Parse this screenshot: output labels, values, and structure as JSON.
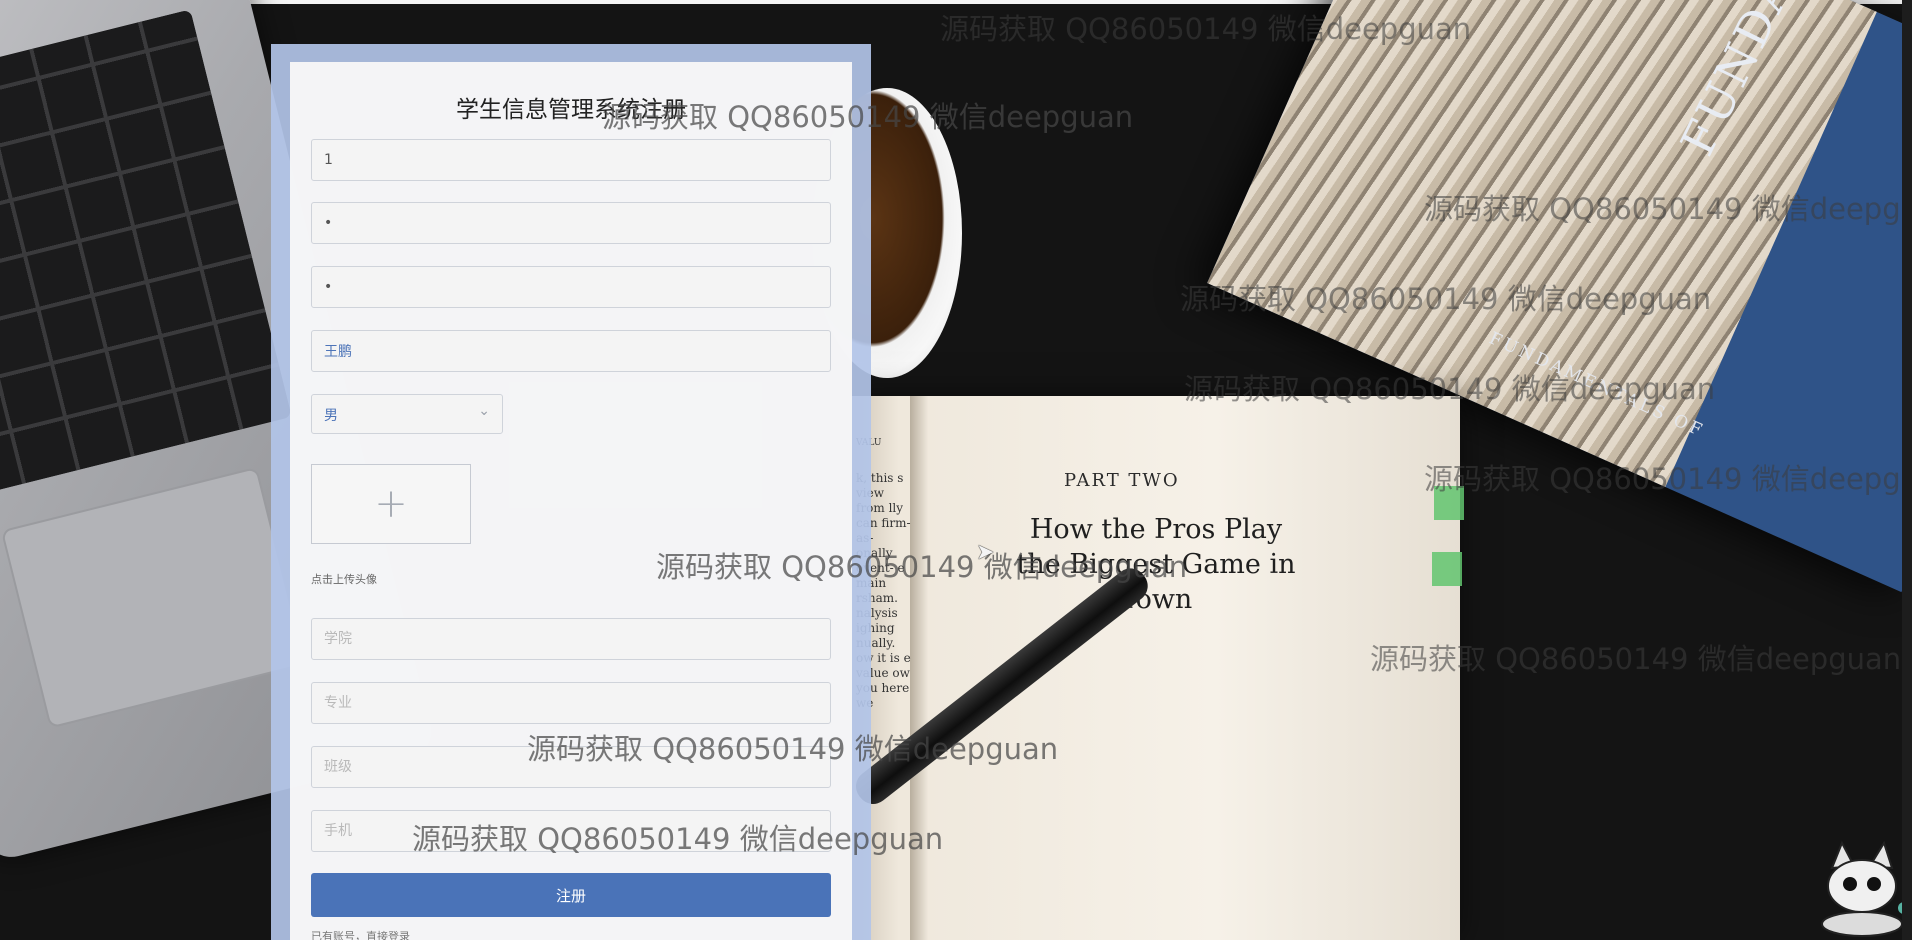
{
  "form": {
    "title": "学生信息管理系统注册",
    "fields": {
      "account": {
        "value": "1",
        "placeholder": ""
      },
      "password": {
        "value": "•",
        "placeholder": ""
      },
      "confirm_password": {
        "value": "•",
        "placeholder": ""
      },
      "name": {
        "value": "王鹏",
        "placeholder": ""
      },
      "college": {
        "value": "",
        "placeholder": "学院"
      },
      "major": {
        "value": "",
        "placeholder": "专业"
      },
      "class": {
        "value": "",
        "placeholder": "班级"
      },
      "phone": {
        "value": "",
        "placeholder": "手机"
      }
    },
    "gender_select": {
      "value": "男"
    },
    "upload": {
      "plus": "+",
      "hint": "点击上传头像"
    },
    "submit_label": "注册",
    "login_link": "已有账号，直接登录"
  },
  "watermark": "源码获取 QQ86050149 微信deepguan",
  "background": {
    "book_part": "PART TWO",
    "book_heading": "How the Pros Play the Biggest Game in Town",
    "book_left_text": "k, this s view from lly can firm- as- onally ovent- e main rsham. nalysis ighing nually. ow it is e value ow you here we",
    "book_left_header": "VALU",
    "book_right_title": "FUNDAMENTALS OF CORPORATE",
    "book_right_spine": "FUNDAMENTALS OF",
    "book_right_author": "SCHU"
  },
  "colors": {
    "panel_frame": "#b2c4e8",
    "button": "#4a73b8",
    "selected_text": "#4d74b8"
  }
}
